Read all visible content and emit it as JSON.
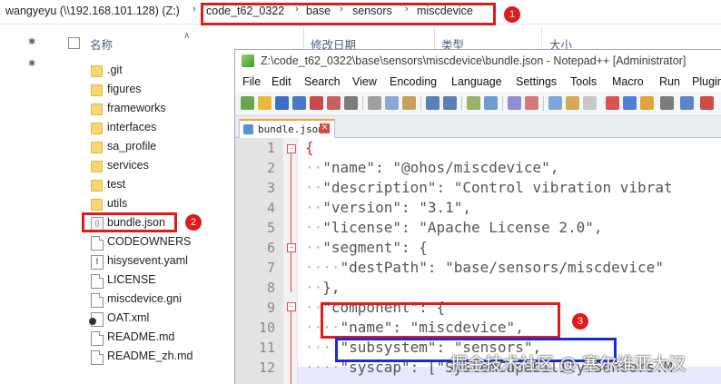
{
  "explorer": {
    "breadcrumb": [
      "wangyeyu (\\\\192.168.101.128) (Z:)",
      "code_t62_0322",
      "base",
      "sensors",
      "miscdevice"
    ],
    "columns": {
      "name": "名称",
      "date": "修改日期",
      "type": "类型",
      "size": "大小"
    },
    "files": [
      {
        "name": ".git",
        "kind": "folder"
      },
      {
        "name": "figures",
        "kind": "folder"
      },
      {
        "name": "frameworks",
        "kind": "folder"
      },
      {
        "name": "interfaces",
        "kind": "folder"
      },
      {
        "name": "sa_profile",
        "kind": "folder"
      },
      {
        "name": "services",
        "kind": "folder"
      },
      {
        "name": "test",
        "kind": "folder"
      },
      {
        "name": "utils",
        "kind": "folder"
      },
      {
        "name": "bundle.json",
        "kind": "json"
      },
      {
        "name": "CODEOWNERS",
        "kind": "file"
      },
      {
        "name": "hisysevent.yaml",
        "kind": "yaml"
      },
      {
        "name": "LICENSE",
        "kind": "file"
      },
      {
        "name": "miscdevice.gni",
        "kind": "file"
      },
      {
        "name": "OAT.xml",
        "kind": "xml"
      },
      {
        "name": "README.md",
        "kind": "file"
      },
      {
        "name": "README_zh.md",
        "kind": "file"
      }
    ]
  },
  "notepad": {
    "title": "Z:\\code_t62_0322\\base\\sensors\\miscdevice\\bundle.json - Notepad++ [Administrator]",
    "menu": [
      "File",
      "Edit",
      "Search",
      "View",
      "Encoding",
      "Language",
      "Settings",
      "Tools",
      "Macro",
      "Run",
      "Plugin"
    ],
    "tab_label": "bundle.json",
    "lines": [
      {
        "n": "1",
        "dots": "",
        "text": "{"
      },
      {
        "n": "2",
        "dots": "··",
        "text": "\"name\": \"@ohos/miscdevice\","
      },
      {
        "n": "3",
        "dots": "··",
        "text": "\"description\": \"Control vibration vibrat"
      },
      {
        "n": "4",
        "dots": "··",
        "text": "\"version\": \"3.1\","
      },
      {
        "n": "5",
        "dots": "··",
        "text": "\"license\": \"Apache License 2.0\","
      },
      {
        "n": "6",
        "dots": "··",
        "text": "\"segment\": {"
      },
      {
        "n": "7",
        "dots": "····",
        "text": "\"destPath\": \"base/sensors/miscdevice\""
      },
      {
        "n": "8",
        "dots": "··",
        "text": "},"
      },
      {
        "n": "9",
        "dots": "··",
        "text": "\"component\": {"
      },
      {
        "n": "10",
        "dots": "····",
        "text": "\"name\": \"miscdevice\","
      },
      {
        "n": "11",
        "dots": "····",
        "text": "\"subsystem\": \"sensors\","
      },
      {
        "n": "12",
        "dots": "····",
        "text": "\"syscap\": [\"SystemCapability.Sensors.M"
      }
    ]
  },
  "annotations": {
    "badge_1": "1",
    "badge_2": "2",
    "badge_3": "3"
  },
  "watermark": "掘金技术社区 @ 塞尔维亚大汉",
  "colors": {
    "annotation_red": "#e01b1b",
    "annotation_blue": "#1a2bd6",
    "fold_marker": "#d95050",
    "current_line": "#e8e8ff"
  }
}
